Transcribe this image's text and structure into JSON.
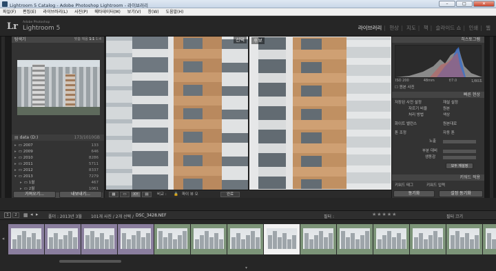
{
  "window": {
    "title": "Lightroom 5 Catalog - Adobe Photoshop Lightroom - 라이브러리",
    "minimize": "–",
    "maximize": "□",
    "close": "✕"
  },
  "menu": [
    "파일(F)",
    "편집(E)",
    "라이브러리(L)",
    "사진(P)",
    "메타데이터(M)",
    "보기(V)",
    "창(W)",
    "도움말(H)"
  ],
  "brand": {
    "logo": "Lr",
    "sub1": "Adobe Photoshop",
    "sub2": "Lightroom 5"
  },
  "modules": [
    "라이브러리",
    "현상",
    "지도",
    "책",
    "슬라이드 쇼",
    "인쇄",
    "웹"
  ],
  "active_module": "라이브러리",
  "left": {
    "navigator_title": "탐색기",
    "navigator_zoom": [
      "맞춤",
      "채움",
      "1:1",
      "1:4"
    ],
    "folders_volume": "data (D:)",
    "folders_volume_size": "173/1010GB",
    "folders": [
      {
        "name": "2007",
        "count": "133"
      },
      {
        "name": "2009",
        "count": "646"
      },
      {
        "name": "2010",
        "count": "8286"
      },
      {
        "name": "2011",
        "count": "5711"
      },
      {
        "name": "2012",
        "count": "8337"
      },
      {
        "name": "2013",
        "count": "7279"
      },
      {
        "name": "1월",
        "count": "467"
      },
      {
        "name": "2월",
        "count": "1061"
      },
      {
        "name": "3월",
        "count": "920"
      }
    ],
    "import_button": "가져오기...",
    "export_button": "내보내기..."
  },
  "center": {
    "select_label": "선택",
    "candidate_label": "후보"
  },
  "toolbar": {
    "compare_label": "비교 :",
    "color_label": "파이 뷰 오",
    "done_button": "완료"
  },
  "right": {
    "histogram_title": "히스토그램",
    "histo_info": [
      "ISO 200",
      "48mm",
      "f/7.0",
      "1/80초"
    ],
    "original_photo": "원본 사진",
    "quick_develop": "빠른 현상",
    "saved_preset": "저장된 사전 설정",
    "saved_preset_value": "재설 설정",
    "crop_ratio": "자르기 비율",
    "crop_ratio_value": "원본",
    "treatment": "처리 방법",
    "treatment_value": "색상",
    "white_balance": "화이트 밸런스",
    "white_balance_value": "원본대로",
    "tone_control": "톤 조정",
    "auto_tone": "자동 톤",
    "exposure": "노출",
    "clarity": "부분 대비",
    "vibrance": "생동감",
    "reset_all": "모두 재설정",
    "keywords": "키워드 적용",
    "keyword_tags": "키워드 태그",
    "keyword_entry": "키워드 입력",
    "sync_button": "동기화",
    "sync_settings_button": "설정 동기화"
  },
  "filmbar": {
    "pages": [
      "1",
      "2"
    ],
    "source": "폴더 : 2013년 3월",
    "count": "101개 사진 / 2개 선택 /",
    "filename": "DSC_3428.NEF",
    "filter_label": "필터 :",
    "filter_off": "필터 끄기"
  },
  "filmstrip": {
    "thumb_count": 14,
    "selected_index": 7
  },
  "colors": {
    "accent": "#e6e6e6",
    "purple_tint": "#8a7e9e",
    "green_tint": "#7c9478"
  }
}
